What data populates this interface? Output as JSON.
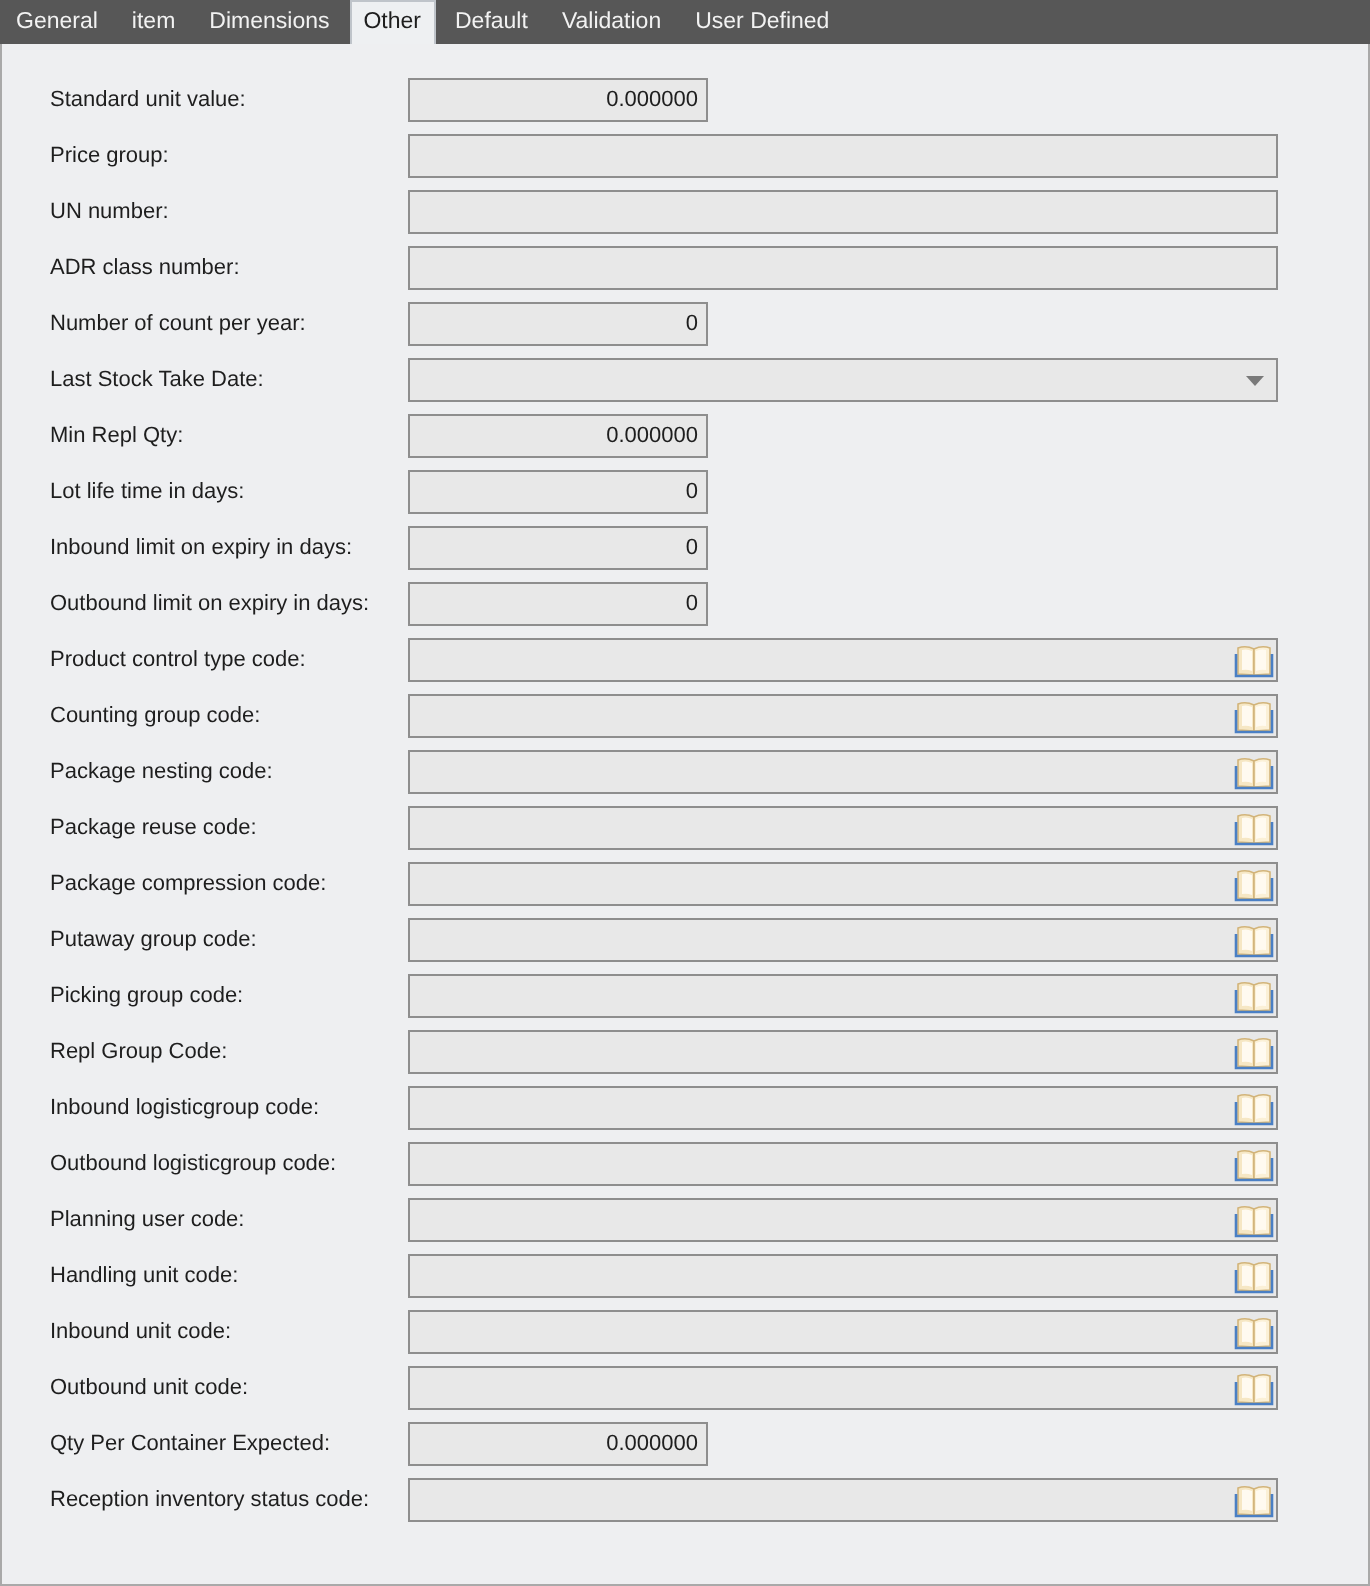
{
  "tabs": [
    {
      "label": "General",
      "selected": false
    },
    {
      "label": "item",
      "selected": false
    },
    {
      "label": "Dimensions",
      "selected": false
    },
    {
      "label": "Other",
      "selected": true
    },
    {
      "label": "Default",
      "selected": false
    },
    {
      "label": "Validation",
      "selected": false
    },
    {
      "label": "User Defined",
      "selected": false
    }
  ],
  "fields": [
    {
      "label": "Standard unit value:",
      "kind": "number",
      "value": "0.000000"
    },
    {
      "label": "Price group:",
      "kind": "text"
    },
    {
      "label": "UN number:",
      "kind": "text"
    },
    {
      "label": "ADR class number:",
      "kind": "text"
    },
    {
      "label": "Number of count per year:",
      "kind": "number",
      "value": "0"
    },
    {
      "label": "Last Stock Take Date:",
      "kind": "dropdown"
    },
    {
      "label": "Min Repl Qty:",
      "kind": "number",
      "value": "0.000000"
    },
    {
      "label": "Lot life time in days:",
      "kind": "number",
      "value": "0"
    },
    {
      "label": "Inbound limit on expiry in days:",
      "kind": "number",
      "value": "0"
    },
    {
      "label": "Outbound limit on expiry in days:",
      "kind": "number",
      "value": "0"
    },
    {
      "label": "Product control type code:",
      "kind": "lookup"
    },
    {
      "label": "Counting group code:",
      "kind": "lookup"
    },
    {
      "label": "Package nesting code:",
      "kind": "lookup"
    },
    {
      "label": "Package reuse code:",
      "kind": "lookup"
    },
    {
      "label": "Package compression code:",
      "kind": "lookup"
    },
    {
      "label": "Putaway group code:",
      "kind": "lookup"
    },
    {
      "label": "Picking group code:",
      "kind": "lookup"
    },
    {
      "label": "Repl Group Code:",
      "kind": "lookup"
    },
    {
      "label": "Inbound logisticgroup code:",
      "kind": "lookup"
    },
    {
      "label": "Outbound logisticgroup code:",
      "kind": "lookup"
    },
    {
      "label": "Planning user code:",
      "kind": "lookup"
    },
    {
      "label": "Handling unit code:",
      "kind": "lookup"
    },
    {
      "label": "Inbound unit code:",
      "kind": "lookup"
    },
    {
      "label": "Outbound unit code:",
      "kind": "lookup"
    },
    {
      "label": "Qty Per Container Expected:",
      "kind": "number",
      "value": "0.000000"
    },
    {
      "label": "Reception inventory status code:",
      "kind": "lookup"
    }
  ]
}
